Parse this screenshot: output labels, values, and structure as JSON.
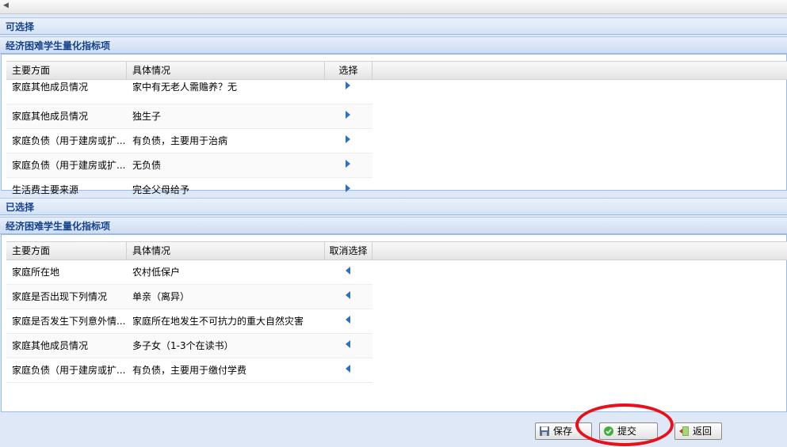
{
  "available": {
    "title": "可选择",
    "subtitle": "经济困难学生量化指标项",
    "columns": [
      "主要方面",
      "具体情况",
      "选择"
    ],
    "rows": [
      {
        "aspect": "家庭其他成员情况",
        "detail": "家中有无老人需赡养？无"
      },
      {
        "aspect": "家庭其他成员情况",
        "detail": "独生子"
      },
      {
        "aspect": "家庭负债（用于建房或扩...",
        "detail": "有负债，主要用于治病"
      },
      {
        "aspect": "家庭负债（用于建房或扩...",
        "detail": "无负债"
      },
      {
        "aspect": "生活费主要来源",
        "detail": "完全父母给予"
      }
    ]
  },
  "selected": {
    "title": "已选择",
    "subtitle": "经济困难学生量化指标项",
    "columns": [
      "主要方面",
      "具体情况",
      "取消选择"
    ],
    "rows": [
      {
        "aspect": "家庭所在地",
        "detail": "农村低保户"
      },
      {
        "aspect": "家庭是否出现下列情况",
        "detail": "单亲（离异）"
      },
      {
        "aspect": "家庭是否发生下列意外情...",
        "detail": "家庭所在地发生不可抗力的重大自然灾害"
      },
      {
        "aspect": "家庭其他成员情况",
        "detail": "多子女（1-3个在读书）"
      },
      {
        "aspect": "家庭负债（用于建房或扩...",
        "detail": "有负债，主要用于缴付学费"
      }
    ]
  },
  "buttons": {
    "save": "保存",
    "submit": "提交",
    "back": "返回"
  },
  "colors": {
    "header_text": "#15428b",
    "panel_bg": "#dfe8f6",
    "select_arrow": "#2a6fc9",
    "annotation_circle": "#e8101a"
  },
  "icons": {
    "select": "triangle-right-icon",
    "deselect": "triangle-left-icon",
    "save": "save-icon",
    "submit": "check-circle-icon",
    "back": "back-icon"
  }
}
